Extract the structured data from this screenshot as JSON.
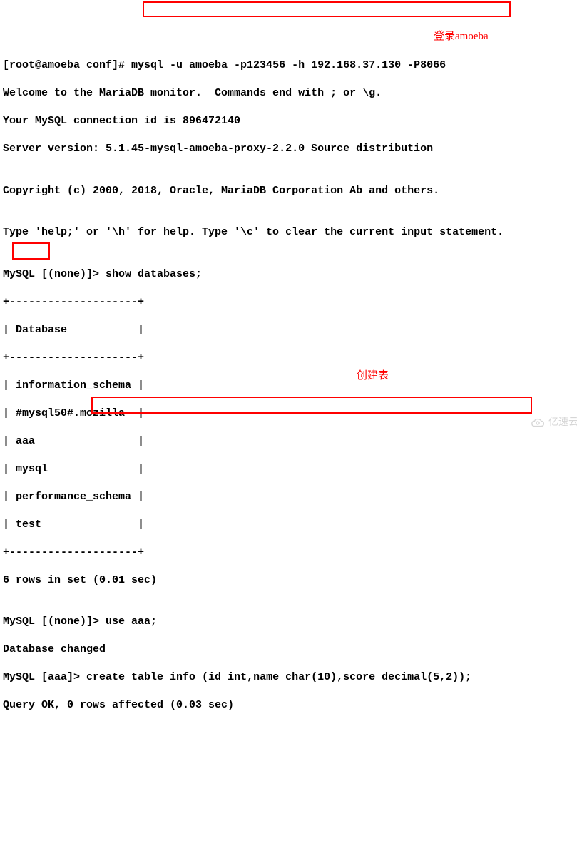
{
  "terminal": {
    "prompt0": "[root@amoeba conf]# ",
    "cmd0": "mysql -u amoeba -p123456 -h 192.168.37.130 -P8066",
    "welcome1": "Welcome to the MariaDB monitor.  Commands end with ; or \\g.",
    "welcome2": "Your MySQL connection id is 896472140",
    "welcome3": "Server version: 5.1.45-mysql-amoeba-proxy-2.2.0 Source distribution",
    "blank": "",
    "copyright": "Copyright (c) 2000, 2018, Oracle, MariaDB Corporation Ab and others.",
    "help": "Type 'help;' or '\\h' for help. Type '\\c' to clear the current input statement.",
    "prompt1": "MySQL [(none)]> ",
    "cmd1": "show databases;",
    "sep_top": "+--------------------+",
    "hdr_row": "| Database           |",
    "sep_mid": "+--------------------+",
    "row0": "| information_schema |",
    "row1": "| #mysql50#.mozilla  |",
    "row2": "| aaa                |",
    "row3": "| mysql              |",
    "row4": "| performance_schema |",
    "row5": "| test               |",
    "sep_bot": "+--------------------+",
    "result1": "6 rows in set (0.01 sec)",
    "prompt2": "MySQL [(none)]> ",
    "cmd2": "use aaa;",
    "result2": "Database changed",
    "prompt3": "MySQL [aaa]> ",
    "cmd3": "create table info (id int,name char(10),score decimal(5,2));",
    "result3": "Query OK, 0 rows affected (0.03 sec)"
  },
  "annotations": {
    "login_amoeba": "登录amoeba",
    "create_table": "创建表"
  },
  "watermark": "亿速云"
}
